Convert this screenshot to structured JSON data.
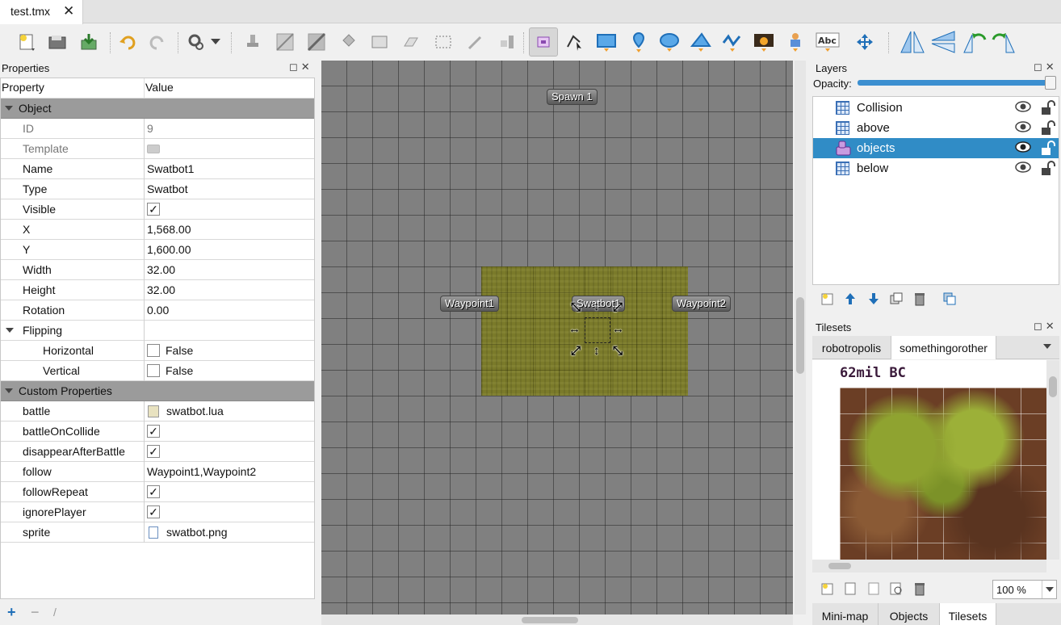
{
  "document_tab": {
    "title": "test.tmx",
    "close": "✕"
  },
  "properties_panel": {
    "title": "Properties",
    "columns": {
      "property": "Property",
      "value": "Value"
    },
    "group_object": "Object",
    "rows": {
      "id": {
        "name": "ID",
        "value": "9"
      },
      "template": {
        "name": "Template"
      },
      "name": {
        "name": "Name",
        "value": "Swatbot1"
      },
      "type": {
        "name": "Type",
        "value": "Swatbot"
      },
      "visible": {
        "name": "Visible",
        "value": "✓"
      },
      "x": {
        "name": "X",
        "value": "1,568.00"
      },
      "y": {
        "name": "Y",
        "value": "1,600.00"
      },
      "width": {
        "name": "Width",
        "value": "32.00"
      },
      "height": {
        "name": "Height",
        "value": "32.00"
      },
      "rotation": {
        "name": "Rotation",
        "value": "0.00"
      },
      "flipping": {
        "name": "Flipping"
      },
      "horizontal": {
        "name": "Horizontal",
        "value": "False"
      },
      "vertical": {
        "name": "Vertical",
        "value": "False"
      }
    },
    "group_custom": "Custom Properties",
    "custom": {
      "battle": {
        "name": "battle",
        "value": "swatbot.lua"
      },
      "battleOnCollide": {
        "name": "battleOnCollide",
        "value": "✓"
      },
      "disappearAfterBattle": {
        "name": "disappearAfterBattle",
        "value": "✓"
      },
      "follow": {
        "name": "follow",
        "value": "Waypoint1,Waypoint2"
      },
      "followRepeat": {
        "name": "followRepeat",
        "value": "✓"
      },
      "ignorePlayer": {
        "name": "ignorePlayer",
        "value": "✓"
      },
      "sprite": {
        "name": "sprite",
        "value": "swatbot.png"
      }
    }
  },
  "map": {
    "objects": {
      "spawn": "Spawn 1",
      "waypoint1": "Waypoint1",
      "waypoint2": "Waypoint2",
      "swatbot": "Swatbot1"
    }
  },
  "layers_panel": {
    "title": "Layers",
    "opacity_label": "Opacity:",
    "opacity_value": 1.0,
    "layers": [
      {
        "name": "Collision",
        "kind": "tile"
      },
      {
        "name": "above",
        "kind": "tile"
      },
      {
        "name": "objects",
        "kind": "object",
        "selected": true
      },
      {
        "name": "below",
        "kind": "tile"
      }
    ]
  },
  "tilesets_panel": {
    "title": "Tilesets",
    "tabs": [
      "robotropolis",
      "somethingorother"
    ],
    "tileset_caption": "62mil BC",
    "zoom": "100 %"
  },
  "bottom_tabs": [
    "Mini-map",
    "Objects",
    "Tilesets"
  ],
  "colors": {
    "selection": "#308cc6",
    "group_header": "#9b9b9b",
    "map_bg": "#808080"
  }
}
